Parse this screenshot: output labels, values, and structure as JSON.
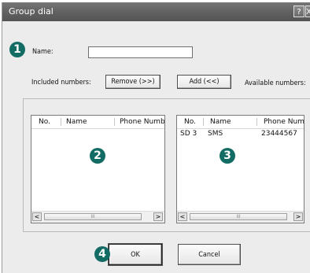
{
  "window": {
    "title": "Group dial",
    "help_label": "?",
    "close_label": "X"
  },
  "form": {
    "name_label": "Name:",
    "name_value": "",
    "included_label": "Included numbers:",
    "available_label": "Available numbers:",
    "remove_button": "Remove (>>)",
    "add_button": "Add (<<)"
  },
  "included_list": {
    "columns": [
      "No.",
      "Name",
      "Phone Numbe"
    ],
    "rows": []
  },
  "available_list": {
    "columns": [
      "No.",
      "Name",
      "Phone Numb"
    ],
    "rows": [
      {
        "no": "SD 3",
        "name": "SMS",
        "phone": "23444567"
      }
    ]
  },
  "scroll": {
    "left_arrow": "<",
    "right_arrow": ">",
    "thumb_grip": "III"
  },
  "buttons": {
    "ok": "OK",
    "cancel": "Cancel"
  },
  "badges": [
    "1",
    "2",
    "3",
    "4"
  ],
  "colors": {
    "badge": "#136c64",
    "titlebar": "#5e5e5e",
    "dialog_bg": "#ececec"
  }
}
